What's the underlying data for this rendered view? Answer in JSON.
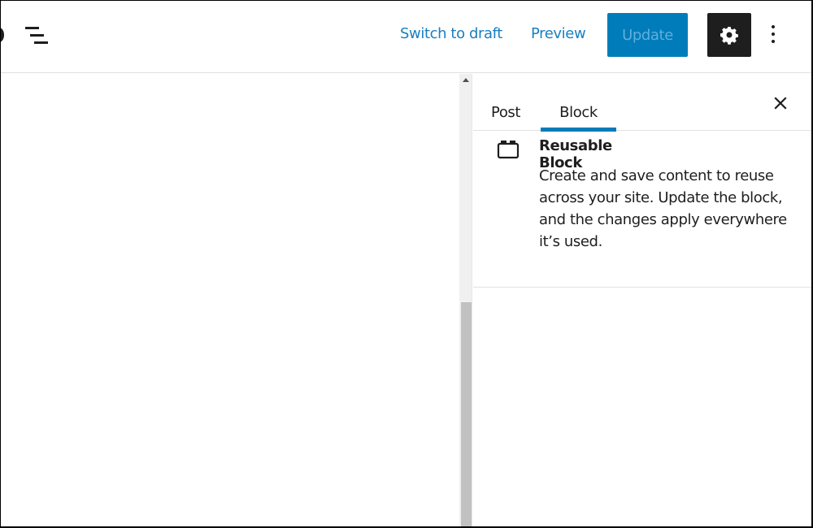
{
  "header": {
    "switch_to_draft_label": "Switch to draft",
    "preview_label": "Preview",
    "update_label": "Update",
    "icons": {
      "list_view": "list-view-icon",
      "settings": "gear-icon",
      "more": "vertical-ellipsis-icon"
    }
  },
  "sidebar": {
    "tabs": [
      {
        "label": "Post",
        "active": false
      },
      {
        "label": "Block",
        "active": true
      }
    ],
    "close_icon": "close-icon",
    "block_card": {
      "icon": "reusable-block-icon",
      "title": "Reusable Block",
      "description": "Create and save content to reuse across your site. Update the block, and the changes apply everywhere it’s used."
    }
  },
  "colors": {
    "accent": "#007cba",
    "link": "#1a7fc0",
    "dark": "#1e1e1e",
    "border": "#e0e0e0"
  }
}
